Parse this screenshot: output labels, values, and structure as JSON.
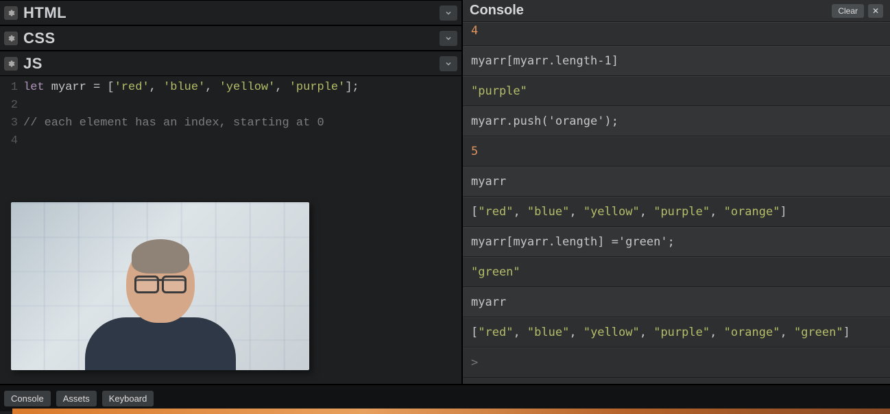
{
  "panels": {
    "html": {
      "title": "HTML"
    },
    "css": {
      "title": "CSS"
    },
    "js": {
      "title": "JS"
    }
  },
  "code": {
    "lines": [
      "1",
      "2",
      "3",
      "4"
    ],
    "l1_kw": "let",
    "l1_rest_a": " myarr = [",
    "l1_s1": "'red'",
    "l1_c1": ", ",
    "l1_s2": "'blue'",
    "l1_c2": ", ",
    "l1_s3": "'yellow'",
    "l1_c3": ", ",
    "l1_s4": "'purple'",
    "l1_end": "];",
    "l3_comment": "// each element has an index, starting at 0"
  },
  "console": {
    "title": "Console",
    "clear_label": "Clear",
    "entries": [
      {
        "kind": "result-number",
        "text": "4"
      },
      {
        "kind": "input",
        "text": "myarr[myarr.length-1]"
      },
      {
        "kind": "result-string",
        "text": "\"purple\""
      },
      {
        "kind": "input",
        "text": "myarr.push('orange');"
      },
      {
        "kind": "result-number",
        "text": "5"
      },
      {
        "kind": "input",
        "text": "myarr"
      },
      {
        "kind": "result-array",
        "items": [
          "\"red\"",
          "\"blue\"",
          "\"yellow\"",
          "\"purple\"",
          "\"orange\""
        ]
      },
      {
        "kind": "input",
        "text": "myarr[myarr.length] ='green';"
      },
      {
        "kind": "result-string",
        "text": "\"green\""
      },
      {
        "kind": "input",
        "text": "myarr"
      },
      {
        "kind": "result-array",
        "items": [
          "\"red\"",
          "\"blue\"",
          "\"yellow\"",
          "\"purple\"",
          "\"orange\"",
          "\"green\""
        ]
      }
    ],
    "prompt": ">"
  },
  "footer": {
    "tabs": [
      "Console",
      "Assets",
      "Keyboard"
    ]
  }
}
